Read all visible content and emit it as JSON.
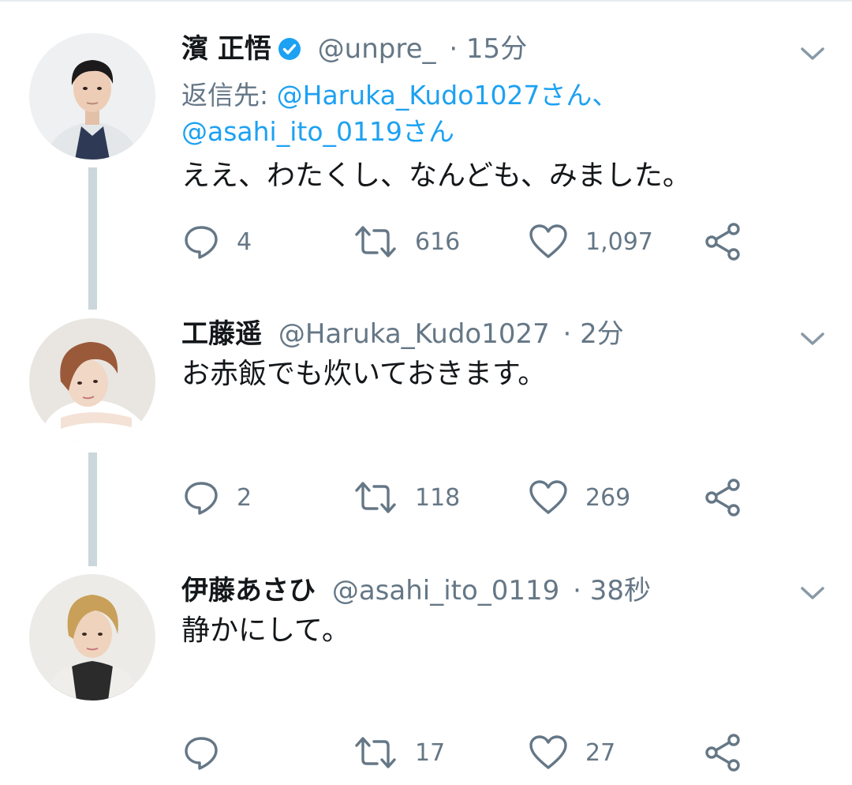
{
  "tweets": [
    {
      "name": "濱 正悟",
      "verified": true,
      "handle": "@unpre_",
      "time": "· 15分",
      "reply_label": "返信先:",
      "reply_1": "@Haruka_Kudo1027さん、",
      "reply_2": "@asahi_ito_0119さん",
      "text": "ええ、わたくし、なんども、みました。",
      "replies": "4",
      "retweets": "616",
      "likes": "1,097"
    },
    {
      "name": "工藤遥",
      "handle": "@Haruka_Kudo1027",
      "time": "· 2分",
      "text": "お赤飯でも炊いておきます。",
      "replies": "2",
      "retweets": "118",
      "likes": "269"
    },
    {
      "name": "伊藤あさひ",
      "handle": "@asahi_ito_0119",
      "time": "· 38秒",
      "text": "静かにして。",
      "replies": "",
      "retweets": "17",
      "likes": "27"
    }
  ],
  "icons": {
    "reply": "reply-icon",
    "retweet": "retweet-icon",
    "like": "heart-icon",
    "share": "share-icon",
    "more": "chevron-down-icon",
    "verified": "verified-badge-icon"
  },
  "colors": {
    "link": "#1da1f2",
    "meta": "#657786",
    "thread_line": "#ccd6dd",
    "verified": "#1da1f2"
  }
}
